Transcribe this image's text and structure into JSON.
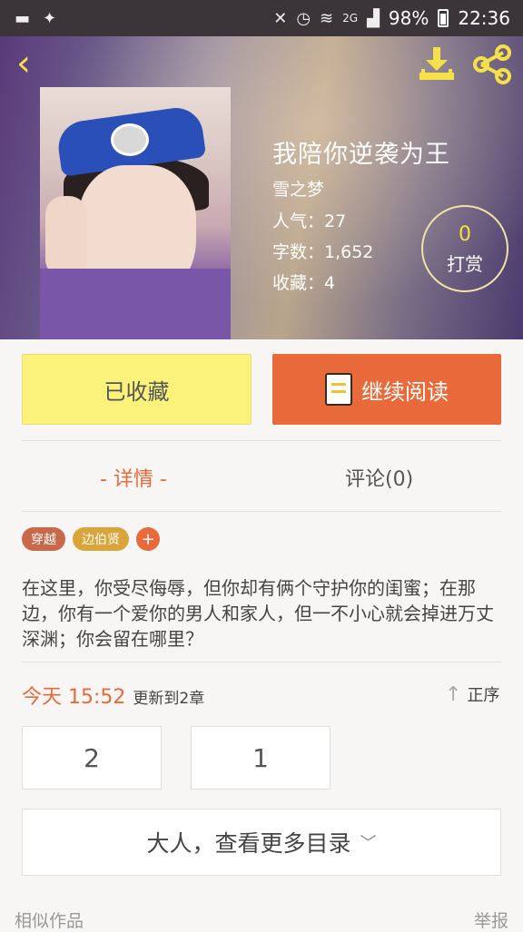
{
  "status_bar": {
    "battery": "98%",
    "time": "22:36",
    "network": "2G"
  },
  "book": {
    "title": "我陪你逆袭为王",
    "author": "雪之梦",
    "popularity": "人气：27",
    "word_count": "字数：1,652",
    "favorites": "收藏：4"
  },
  "tip": {
    "count": "0",
    "label": "打赏"
  },
  "actions": {
    "favorited": "已收藏",
    "continue_reading": "继续阅读"
  },
  "tabs": {
    "detail": "- 详情 -",
    "comments": "评论(0)"
  },
  "tags": [
    "穿越",
    "边伯贤"
  ],
  "tag_add": "+",
  "description": "在这里，你受尽侮辱，但你却有俩个守护你的闺蜜；在那边，你有一个爱你的男人和家人，但一不小心就会掉进万丈深渊；你会留在哪里？",
  "update": {
    "time": "今天 15:52",
    "text": "更新到2章",
    "order": "正序"
  },
  "chapters": [
    "2",
    "1"
  ],
  "more_catalog": "大人，查看更多目录",
  "footer": {
    "similar": "相似作品",
    "report": "举报"
  },
  "colors": {
    "accent": "#e86a3a",
    "yellow": "#fbf27c",
    "icon_yellow": "#f5e04a"
  }
}
